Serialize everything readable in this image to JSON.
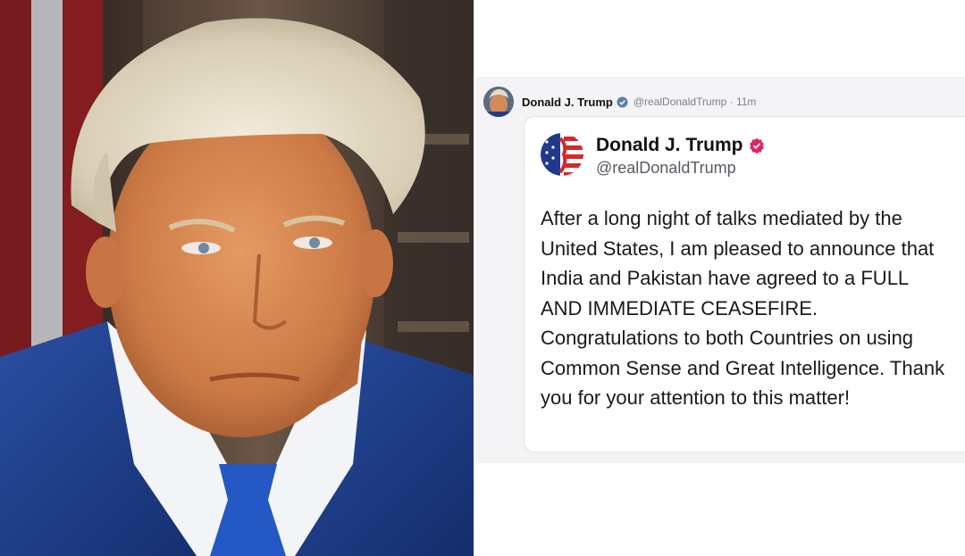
{
  "photo": {
    "subject": "portrait photo"
  },
  "post": {
    "author_name": "Donald J. Trump",
    "author_handle": "@realDonaldTrump",
    "time_meta": "@realDonaldTrump · 11m",
    "verified_icon": "verified-badge-icon",
    "card_author_name": "Donald J. Trump",
    "card_author_handle": "@realDonaldTrump",
    "body": "After a long night of talks mediated by the United States, I am pleased to announce that India and Pakistan have agreed to a FULL AND IMMEDIATE CEASEFIRE. Congratulations to both Countries on using Common Sense and Great Intelligence. Thank you for your attention to this matter!"
  },
  "colors": {
    "badge_blue": "#3b82f6",
    "badge_pink": "#e0245e",
    "suit_blue": "#1f3f8c",
    "tie_blue": "#2458c4"
  }
}
